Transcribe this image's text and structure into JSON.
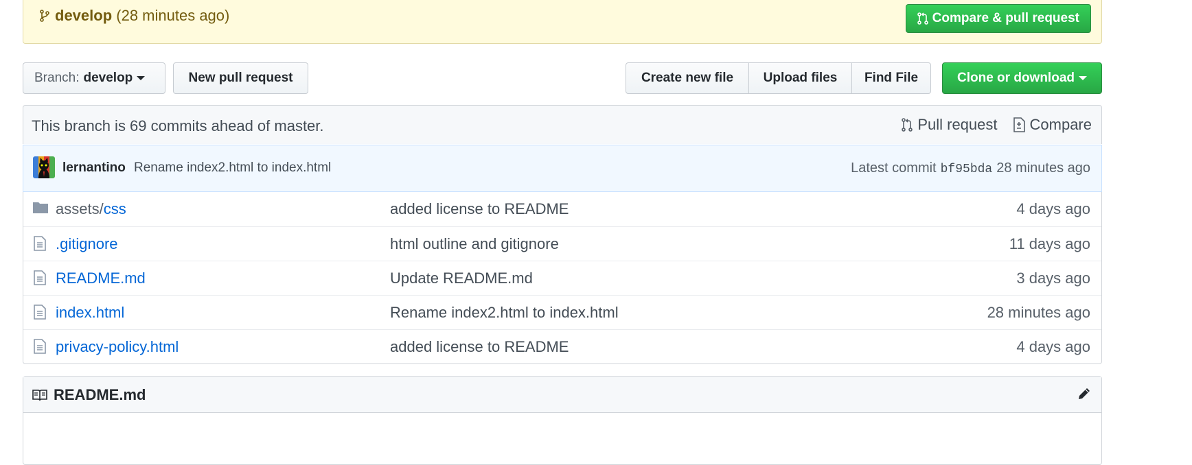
{
  "banner": {
    "branch": "develop",
    "time": "(28 minutes ago)",
    "compare_button": "Compare & pull request"
  },
  "toolbar": {
    "branch_prefix": "Branch:",
    "branch_value": "develop",
    "new_pr": "New pull request",
    "create_file": "Create new file",
    "upload_files": "Upload files",
    "find_file": "Find File",
    "clone": "Clone or download"
  },
  "branch_info": {
    "text": "This branch is 69 commits ahead of master.",
    "pull_request": "Pull request",
    "compare": "Compare"
  },
  "latest_commit": {
    "author": "lernantino",
    "message": "Rename index2.html to index.html",
    "label": "Latest commit",
    "sha": "bf95bda",
    "time": "28 minutes ago"
  },
  "files": [
    {
      "type": "folder",
      "dir": "assets/",
      "name": "css",
      "message": "added license to README",
      "age": "4 days ago"
    },
    {
      "type": "file",
      "dir": "",
      "name": ".gitignore",
      "message": "html outline and gitignore",
      "age": "11 days ago"
    },
    {
      "type": "file",
      "dir": "",
      "name": "README.md",
      "message": "Update README.md",
      "age": "3 days ago"
    },
    {
      "type": "file",
      "dir": "",
      "name": "index.html",
      "message": "Rename index2.html to index.html",
      "age": "28 minutes ago"
    },
    {
      "type": "file",
      "dir": "",
      "name": "privacy-policy.html",
      "message": "added license to README",
      "age": "4 days ago"
    }
  ],
  "readme": {
    "title": "README.md"
  },
  "colors": {
    "link": "#0366d6",
    "green": "#28a745",
    "banner_bg": "#fffbdd"
  }
}
